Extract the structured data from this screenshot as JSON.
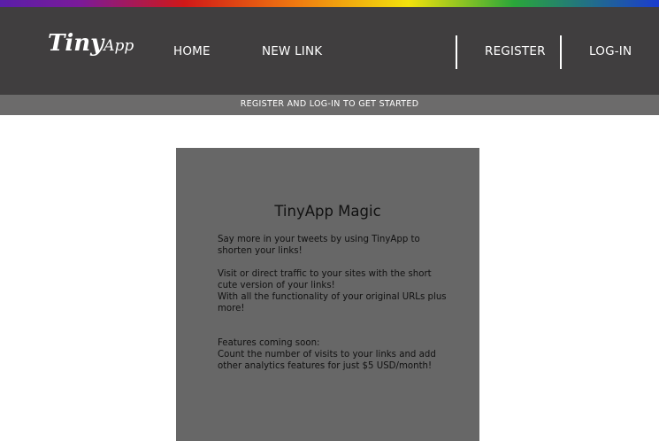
{
  "colors": {
    "navbar_bg": "#403e3f",
    "subbar_bg": "#6c6b6b",
    "card_bg": "#676767",
    "rainbow": [
      "#5a1fa8",
      "#d01818",
      "#f07a10",
      "#f2e20c",
      "#2aa63a",
      "#1a3ccf"
    ]
  },
  "navbar": {
    "logo": {
      "text_big": "Tiny",
      "text_small": "App"
    },
    "left_links": [
      {
        "label": "HOME"
      },
      {
        "label": "NEW LINK"
      }
    ],
    "right_links": [
      {
        "label": "REGISTER"
      },
      {
        "label": "LOG-IN"
      }
    ]
  },
  "subbar": {
    "text": "REGISTER AND LOG-IN TO GET STARTED"
  },
  "card": {
    "title": "TinyApp Magic",
    "paragraph_1": "Say more in your tweets by using TinyApp to shorten your links!",
    "paragraph_2_line_1": "Visit or direct traffic to your sites with the short cute version of your links!",
    "paragraph_2_line_2": "With all the functionality of your original URLs plus more!",
    "paragraph_3_heading": "Features coming soon:",
    "paragraph_3_body": "Count the number of visits to your links and add other analytics features for just $5 USD/month!"
  }
}
